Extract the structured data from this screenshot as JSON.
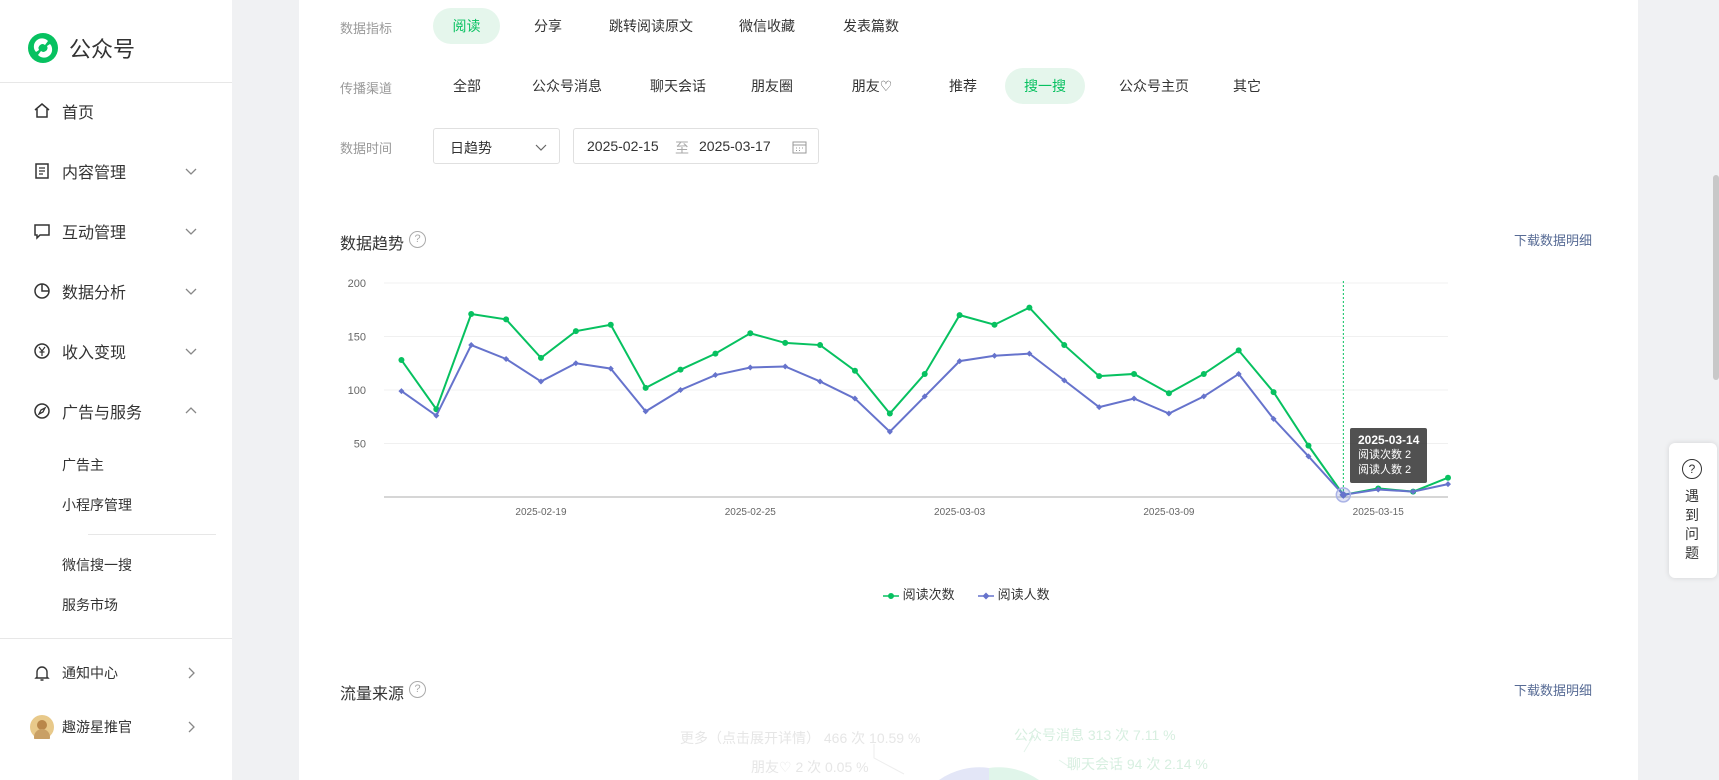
{
  "app": {
    "logo_text": "公众号"
  },
  "sidebar": {
    "home": "首页",
    "content": "内容管理",
    "interaction": "互动管理",
    "analytics": "数据分析",
    "monetize": "收入变现",
    "ads": "广告与服务",
    "ads_sub": [
      "广告主",
      "小程序管理"
    ],
    "search_sub": [
      "微信搜一搜",
      "服务市场"
    ],
    "notify": "通知中心",
    "account": "趣游星推官"
  },
  "filters": {
    "metric_label": "数据指标",
    "metrics": [
      "阅读",
      "分享",
      "跳转阅读原文",
      "微信收藏",
      "发表篇数"
    ],
    "channel_label": "传播渠道",
    "channels": [
      "全部",
      "公众号消息",
      "聊天会话",
      "朋友圈",
      "朋友♡",
      "推荐",
      "搜一搜",
      "公众号主页",
      "其它"
    ],
    "time_label": "数据时间",
    "granularity": "日趋势",
    "date_from": "2025-02-15",
    "date_sep": "至",
    "date_to": "2025-03-17"
  },
  "trend": {
    "title": "数据趋势",
    "download": "下载数据明细",
    "tooltip": {
      "date": "2025-03-14",
      "line1": "阅读次数 2",
      "line2": "阅读人数 2"
    }
  },
  "chart_data": {
    "type": "line",
    "x": [
      "2025-02-15",
      "2025-02-16",
      "2025-02-17",
      "2025-02-18",
      "2025-02-19",
      "2025-02-20",
      "2025-02-21",
      "2025-02-22",
      "2025-02-23",
      "2025-02-24",
      "2025-02-25",
      "2025-02-26",
      "2025-02-27",
      "2025-02-28",
      "2025-03-01",
      "2025-03-02",
      "2025-03-03",
      "2025-03-04",
      "2025-03-05",
      "2025-03-06",
      "2025-03-07",
      "2025-03-08",
      "2025-03-09",
      "2025-03-10",
      "2025-03-11",
      "2025-03-12",
      "2025-03-13",
      "2025-03-14",
      "2025-03-15",
      "2025-03-16",
      "2025-03-17"
    ],
    "xtick_labels": [
      "2025-02-19",
      "2025-02-25",
      "2025-03-03",
      "2025-03-09",
      "2025-03-15"
    ],
    "yticks": [
      "200",
      "150",
      "100",
      "50"
    ],
    "ylim": [
      0,
      200
    ],
    "grid": true,
    "legend_position": "bottom-center",
    "series": [
      {
        "name": "阅读次数",
        "color": "#07c160",
        "marker": "circle",
        "values": [
          128,
          82,
          171,
          166,
          130,
          155,
          161,
          102,
          119,
          134,
          153,
          144,
          142,
          118,
          78,
          115,
          170,
          161,
          177,
          142,
          113,
          115,
          97,
          115,
          137,
          98,
          48,
          2,
          8,
          5,
          18
        ]
      },
      {
        "name": "阅读人数",
        "color": "#6673cc",
        "marker": "diamond",
        "values": [
          99,
          76,
          142,
          129,
          108,
          125,
          120,
          80,
          100,
          114,
          121,
          122,
          108,
          92,
          61,
          94,
          127,
          132,
          134,
          109,
          84,
          92,
          78,
          94,
          115,
          73,
          38,
          2,
          7,
          5,
          12
        ]
      }
    ],
    "highlight_index": 27
  },
  "traffic": {
    "title": "流量来源",
    "download": "下载数据明细",
    "labels": [
      "更多（点击展开详情） 466 次 10.59 %",
      "朋友♡ 2 次 0.05 %",
      "公众号消息 313 次 7.11 %",
      "聊天会话 94 次 2.14 %"
    ]
  },
  "feedback": {
    "label": "遇到问题",
    "icon": "?"
  },
  "colors": {
    "brand": "#07c160",
    "link": "#576b95",
    "series2": "#6673cc"
  }
}
